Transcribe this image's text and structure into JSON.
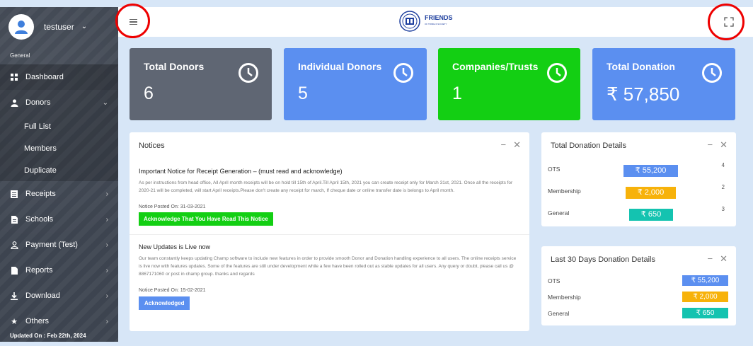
{
  "sidebar": {
    "username": "testuser",
    "section": "General",
    "items": [
      {
        "label": "Dashboard",
        "icon": "dashboard-icon"
      },
      {
        "label": "Donors",
        "icon": "user-icon"
      },
      {
        "label": "Receipts",
        "icon": "receipt-icon"
      },
      {
        "label": "Schools",
        "icon": "document-icon"
      },
      {
        "label": "Payment (Test)",
        "icon": "user-outline-icon"
      },
      {
        "label": "Reports",
        "icon": "report-icon"
      },
      {
        "label": "Download",
        "icon": "download-icon"
      },
      {
        "label": "Others",
        "icon": "star-icon"
      }
    ],
    "donor_sub": [
      "Full List",
      "Members",
      "Duplicate"
    ],
    "updated": "Updated On : Feb 22th, 2024"
  },
  "header": {
    "logo_text": "FRIENDS",
    "logo_sub": "OF TRIBALS SOCIETY"
  },
  "stats": [
    {
      "title": "Total Donors",
      "value": "6",
      "color": "#5f6673"
    },
    {
      "title": "Individual Donors",
      "value": "5",
      "color": "#5b8ff0"
    },
    {
      "title": "Companies/Trusts",
      "value": "1",
      "color": "#13cf13"
    },
    {
      "title": "Total Donation",
      "value": "₹ 57,850",
      "color": "#5b8ff0"
    }
  ],
  "notices": {
    "title": "Notices",
    "items": [
      {
        "heading": "Important Notice for Receipt Generation – (must read and acknowledge)",
        "body": "As per instructions from head office, All April month receipts will be on hold till 15th of April.Till April 15th, 2021 you can create receipt only for March 31st, 2021. Once all the receipts for 2020-21 will be completed, will start April receipts.Please don't create any receipt for march, If cheque date or online transfer date is belongs to April month.",
        "posted": "Notice Posted On: 31-03-2021",
        "button": "Acknowledge That You Have Read This Notice"
      },
      {
        "heading": "New Updates is Live now",
        "body": "Our team constantly keeps updating Champ software to include new features in order to provide smooth Donor and Donation handling experience to all users. The online receipts service is live now with features updates. Some of the features are still under development while a few have been rolled out as stable updates for all users. Any query or doubt, please call us @ 8867171060 or post in champ group. thanks and regards",
        "posted": "Notice Posted On: 15-02-2021",
        "button": "Acknowledged"
      }
    ]
  },
  "total_details": {
    "title": "Total Donation Details",
    "rows": [
      {
        "label": "OTS",
        "amount": "₹ 55,200",
        "count": "4",
        "color": "#5b8ff0"
      },
      {
        "label": "Membership",
        "amount": "₹ 2,000",
        "count": "2",
        "color": "#f7b20a"
      },
      {
        "label": "General",
        "amount": "₹ 650",
        "count": "3",
        "color": "#14c3b0"
      }
    ]
  },
  "last30": {
    "title": "Last 30 Days Donation Details",
    "rows": [
      {
        "label": "OTS",
        "amount": "₹ 55,200",
        "color": "#5b8ff0"
      },
      {
        "label": "Membership",
        "amount": "₹ 2,000",
        "color": "#f7b20a"
      },
      {
        "label": "General",
        "amount": "₹ 650",
        "color": "#14c3b0"
      }
    ]
  }
}
